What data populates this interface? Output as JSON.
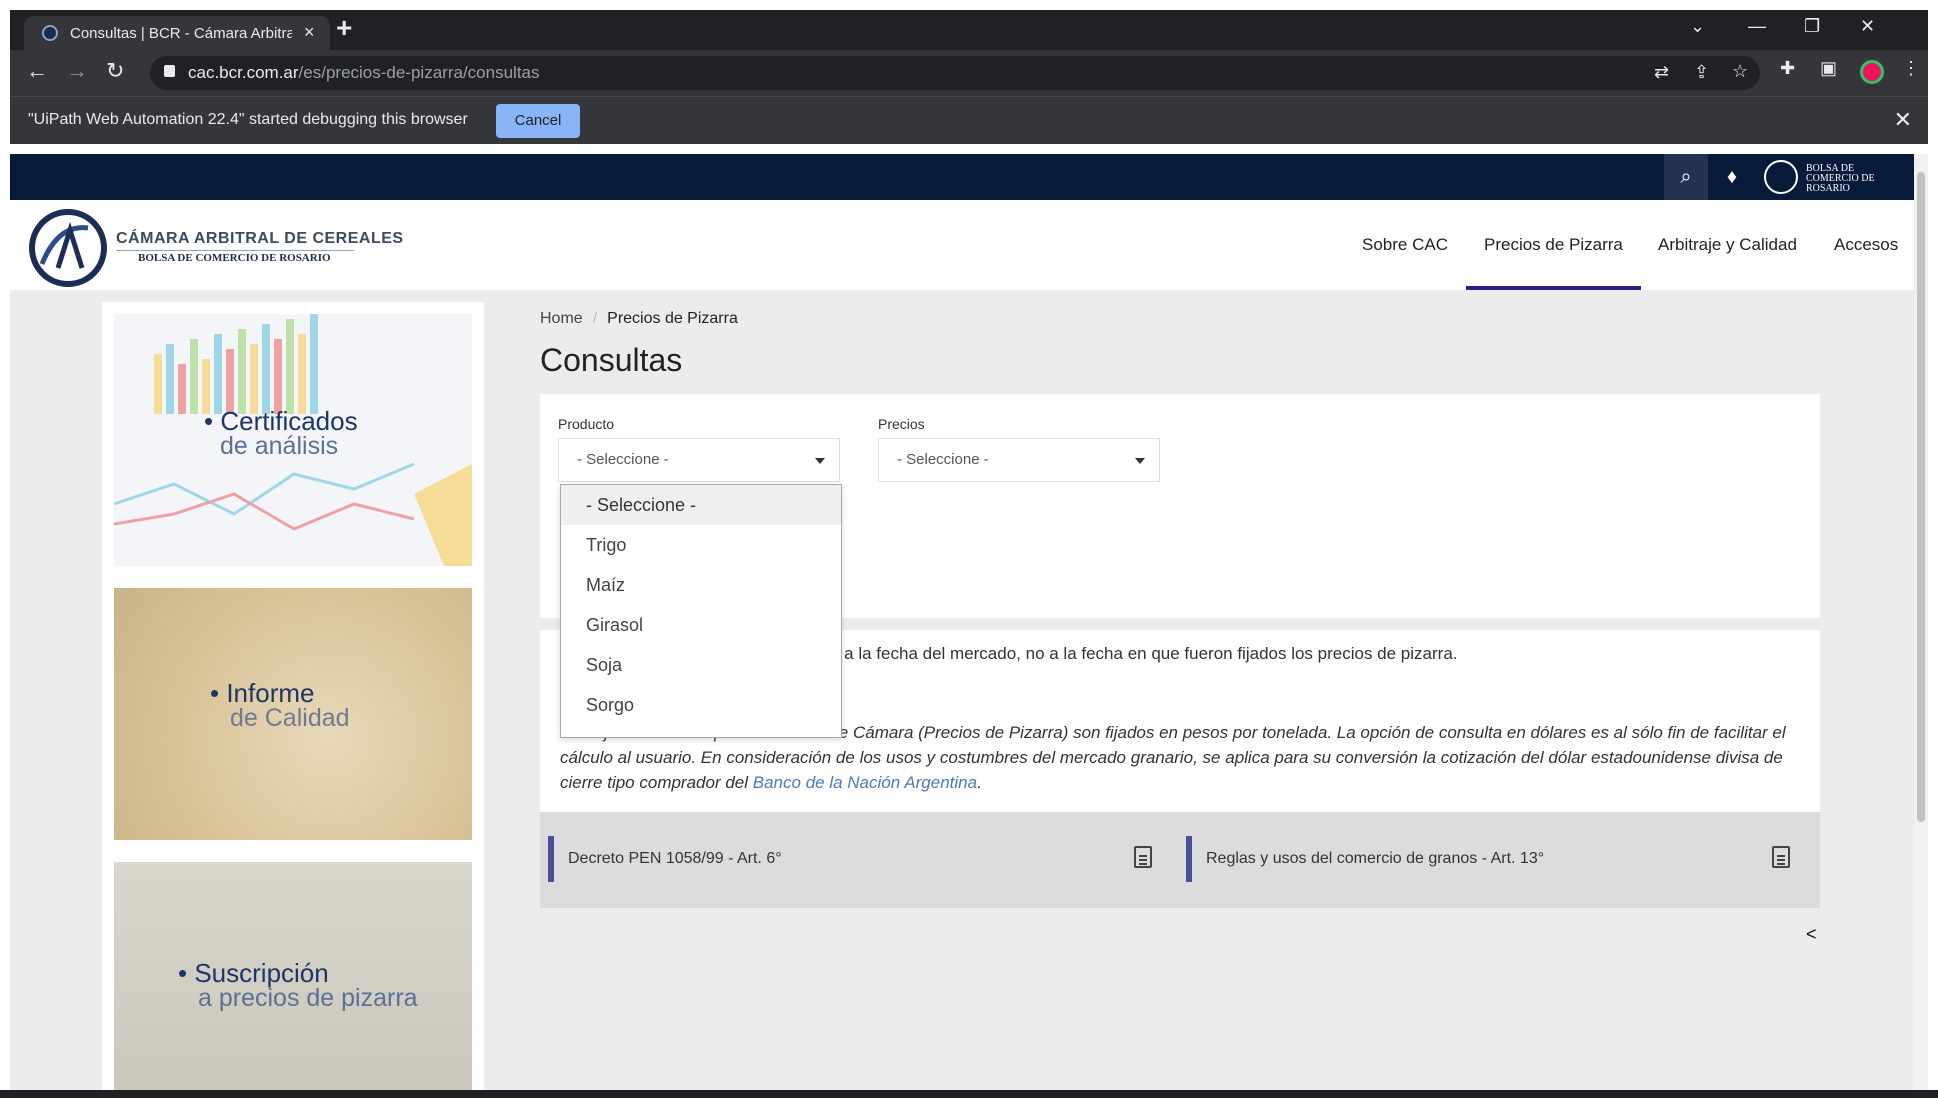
{
  "browser": {
    "tab_title": "Consultas | BCR - Cámara Arbitral de Cereales",
    "url_domain": "cac.bcr.com.ar",
    "url_path": "/es/precios-de-pizarra/consultas",
    "new_tab": "+",
    "infobar_message": "\"UiPath Web Automation 22.4\" started debugging this browser",
    "infobar_cancel": "Cancel"
  },
  "topbar": {
    "bcr_logo_text": "BOLSA DE COMERCIO DE ROSARIO"
  },
  "header": {
    "logo_title": "CÁMARA ARBITRAL DE CEREALES",
    "logo_subtitle": "BOLSA DE COMERCIO DE ROSARIO",
    "nav": [
      "Sobre CAC",
      "Precios de Pizarra",
      "Arbitraje y Calidad",
      "Accesos"
    ],
    "active_nav": "Precios de Pizarra"
  },
  "sidebar": {
    "cards": [
      {
        "line1": "• Certificados",
        "line2": "de análisis"
      },
      {
        "line1": "• Informe",
        "line2": "de Calidad"
      },
      {
        "line1": "• Suscripción",
        "line2": "a precios de pizarra"
      }
    ]
  },
  "breadcrumb": {
    "home": "Home",
    "separator": "/",
    "current": "Precios de Pizarra"
  },
  "page_title": "Consultas",
  "form": {
    "producto_label": "Producto",
    "producto_value": "- Seleccione -",
    "precios_label": "Precios",
    "precios_value": "- Seleccione -"
  },
  "dropdown": {
    "options": [
      "- Seleccione -",
      "Trigo",
      "Maíz",
      "Girasol",
      "Soja",
      "Sorgo"
    ],
    "highlighted": "- Seleccione -"
  },
  "info": {
    "note1": "e a la fecha del mercado, no a la fecha en que fueron fijados los precios de pizarra.",
    "note2": "Se deja constancia que los Precios de Cámara (Precios de Pizarra) son fijados en pesos por tonelada. La opción de consulta en dólares es al sólo fin de facilitar el cálculo al usuario. En consideración de los usos y costumbres del mercado granario, se aplica para su conversión la cotización del dólar estadounidense divisa de cierre tipo comprador del",
    "note2_link": "Banco de la Nación Argentina",
    "note2_end": "."
  },
  "documents": [
    {
      "label": "Decreto PEN 1058/99 - Art. 6°"
    },
    {
      "label": "Reglas y usos del comercio de granos - Art. 13°"
    }
  ],
  "colors": {
    "navy": "#071a3a",
    "accent": "#3a1a8a",
    "link": "#4a7bb7"
  }
}
